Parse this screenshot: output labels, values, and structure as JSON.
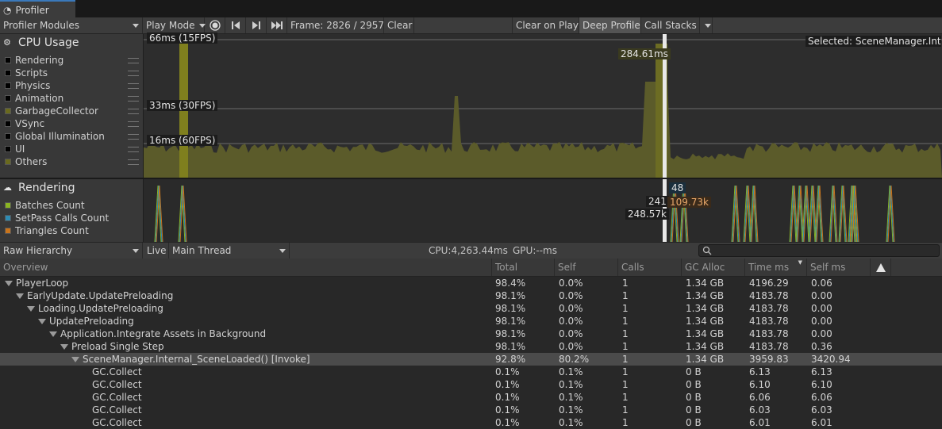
{
  "window": {
    "tab_title": "Profiler"
  },
  "toolbar": {
    "modules_label": "Profiler Modules",
    "play_mode": "Play Mode",
    "frame": "Frame: 2826 / 2957",
    "clear": "Clear",
    "clear_on_play": "Clear on Play",
    "deep_profile": "Deep Profile",
    "call_stacks": "Call Stacks"
  },
  "cpu_module": {
    "title": "CPU Usage",
    "legend": [
      {
        "label": "Rendering",
        "color": "#000000"
      },
      {
        "label": "Scripts",
        "color": "#000000"
      },
      {
        "label": "Physics",
        "color": "#000000"
      },
      {
        "label": "Animation",
        "color": "#000000"
      },
      {
        "label": "GarbageCollector",
        "color": "#6a6a1e"
      },
      {
        "label": "VSync",
        "color": "#000000"
      },
      {
        "label": "Global Illumination",
        "color": "#000000"
      },
      {
        "label": "UI",
        "color": "#000000"
      },
      {
        "label": "Others",
        "color": "#6a6a1e"
      }
    ],
    "line_labels": [
      "66ms (15FPS)",
      "33ms (30FPS)",
      "16ms (60FPS)"
    ],
    "selected_value": "284.61ms",
    "selected_text": "Selected: SceneManager.Inter"
  },
  "rendering_module": {
    "title": "Rendering",
    "legend": [
      {
        "label": "Batches Count",
        "color": "#8ab422"
      },
      {
        "label": "SetPass Calls Count",
        "color": "#2e8cb4"
      },
      {
        "label": "Triangles Count",
        "color": "#c8741c"
      }
    ],
    "values": {
      "v1": "48",
      "v2": "241",
      "v3": "109.73k",
      "v4": "248.57k"
    }
  },
  "hierarchy_bar": {
    "view": "Raw Hierarchy",
    "live": "Live",
    "thread": "Main Thread",
    "cpu": "CPU:4,263.44ms",
    "gpu": "GPU:--ms"
  },
  "columns": {
    "overview": "Overview",
    "total": "Total",
    "self": "Self",
    "calls": "Calls",
    "gc_alloc": "GC Alloc",
    "time_ms": "Time ms",
    "self_ms": "Self ms"
  },
  "rows": [
    {
      "name": "PlayerLoop",
      "total": "98.4%",
      "self": "0.0%",
      "calls": "1",
      "gc": "1.34 GB",
      "time": "4196.29",
      "selfms": "0.06"
    },
    {
      "name": "EarlyUpdate.UpdatePreloading",
      "total": "98.1%",
      "self": "0.0%",
      "calls": "1",
      "gc": "1.34 GB",
      "time": "4183.78",
      "selfms": "0.00"
    },
    {
      "name": "Loading.UpdatePreloading",
      "total": "98.1%",
      "self": "0.0%",
      "calls": "1",
      "gc": "1.34 GB",
      "time": "4183.78",
      "selfms": "0.00"
    },
    {
      "name": "UpdatePreloading",
      "total": "98.1%",
      "self": "0.0%",
      "calls": "1",
      "gc": "1.34 GB",
      "time": "4183.78",
      "selfms": "0.00"
    },
    {
      "name": "Application.Integrate Assets in Background",
      "total": "98.1%",
      "self": "0.0%",
      "calls": "1",
      "gc": "1.34 GB",
      "time": "4183.78",
      "selfms": "0.00"
    },
    {
      "name": "Preload Single Step",
      "total": "98.1%",
      "self": "0.0%",
      "calls": "1",
      "gc": "1.34 GB",
      "time": "4183.78",
      "selfms": "0.36"
    },
    {
      "name": "SceneManager.Internal_SceneLoaded() [Invoke]",
      "total": "92.8%",
      "self": "80.2%",
      "calls": "1",
      "gc": "1.34 GB",
      "time": "3959.83",
      "selfms": "3420.94"
    },
    {
      "name": "GC.Collect",
      "total": "0.1%",
      "self": "0.1%",
      "calls": "1",
      "gc": "0 B",
      "time": "6.13",
      "selfms": "6.13"
    },
    {
      "name": "GC.Collect",
      "total": "0.1%",
      "self": "0.1%",
      "calls": "1",
      "gc": "0 B",
      "time": "6.10",
      "selfms": "6.10"
    },
    {
      "name": "GC.Collect",
      "total": "0.1%",
      "self": "0.1%",
      "calls": "1",
      "gc": "0 B",
      "time": "6.06",
      "selfms": "6.06"
    },
    {
      "name": "GC.Collect",
      "total": "0.1%",
      "self": "0.1%",
      "calls": "1",
      "gc": "0 B",
      "time": "6.03",
      "selfms": "6.03"
    },
    {
      "name": "GC.Collect",
      "total": "0.1%",
      "self": "0.1%",
      "calls": "1",
      "gc": "0 B",
      "time": "6.01",
      "selfms": "6.01"
    }
  ]
}
